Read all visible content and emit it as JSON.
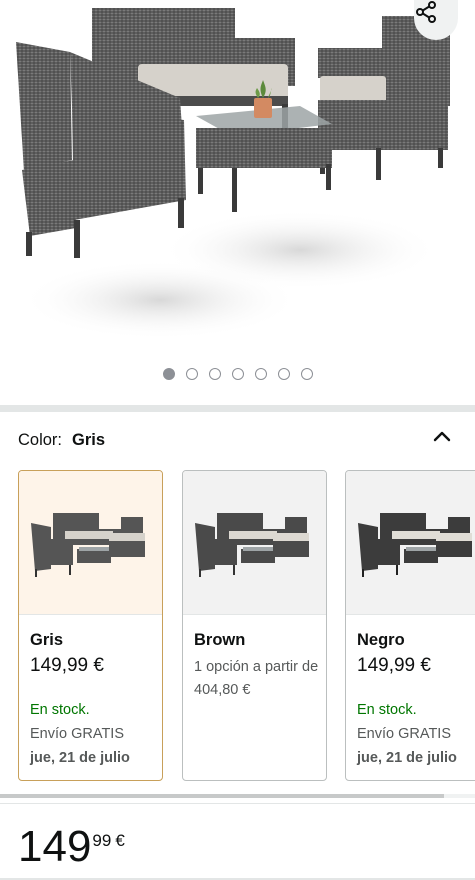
{
  "product": {
    "image_alt": "Conjunto de muebles de ratán gris",
    "carousel": {
      "total": 7,
      "active": 1
    }
  },
  "icons": {
    "share": "share-icon",
    "collapse": "chevron-up-icon"
  },
  "color_selector": {
    "label": "Color:",
    "selected_value": "Gris",
    "options": [
      {
        "name": "Gris",
        "price": "149,99 €",
        "stock": "En stock.",
        "shipping": "Envío GRATIS",
        "delivery": "jue, 21 de julio",
        "selected": true
      },
      {
        "name": "Brown",
        "desc": "1 opción a partir de 404,80 €",
        "selected": false
      },
      {
        "name": "Negro",
        "price": "149,99 €",
        "stock": "En stock.",
        "shipping": "Envío GRATIS",
        "delivery": "jue, 21 de julio",
        "selected": false
      }
    ]
  },
  "price": {
    "whole": "149",
    "fraction": "99",
    "currency": "€"
  },
  "colors": {
    "in_stock": "#007600",
    "selected_border": "#c8a05a",
    "selected_bg": "#fef4e9",
    "text": "#0f1111",
    "muted": "#565959"
  }
}
